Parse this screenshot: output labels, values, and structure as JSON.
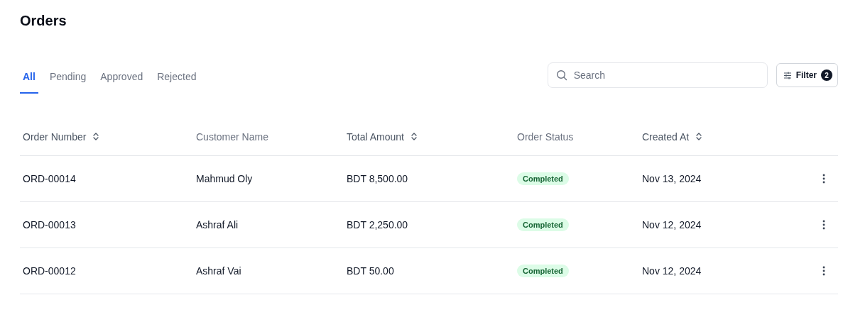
{
  "title": "Orders",
  "tabs": [
    {
      "label": "All",
      "selected": true
    },
    {
      "label": "Pending",
      "selected": false
    },
    {
      "label": "Approved",
      "selected": false
    },
    {
      "label": "Rejected",
      "selected": false
    }
  ],
  "search": {
    "placeholder": "Search"
  },
  "filter": {
    "label": "Filter",
    "count": "2"
  },
  "table": {
    "columns": [
      {
        "label": "Order Number",
        "sortable": true
      },
      {
        "label": "Customer Name",
        "sortable": false
      },
      {
        "label": "Total Amount",
        "sortable": true
      },
      {
        "label": "Order Status",
        "sortable": false
      },
      {
        "label": "Created At",
        "sortable": true
      }
    ],
    "rows": [
      {
        "order_number": "ORD-00014",
        "customer_name": "Mahmud Oly",
        "total_amount": "BDT 8,500.00",
        "status": {
          "label": "Completed",
          "kind": "success"
        },
        "created_at": "Nov 13, 2024"
      },
      {
        "order_number": "ORD-00013",
        "customer_name": "Ashraf Ali",
        "total_amount": "BDT 2,250.00",
        "status": {
          "label": "Completed",
          "kind": "success"
        },
        "created_at": "Nov 12, 2024"
      },
      {
        "order_number": "ORD-00012",
        "customer_name": "Ashraf Vai",
        "total_amount": "BDT 50.00",
        "status": {
          "label": "Completed",
          "kind": "success"
        },
        "created_at": "Nov 12, 2024"
      }
    ]
  }
}
